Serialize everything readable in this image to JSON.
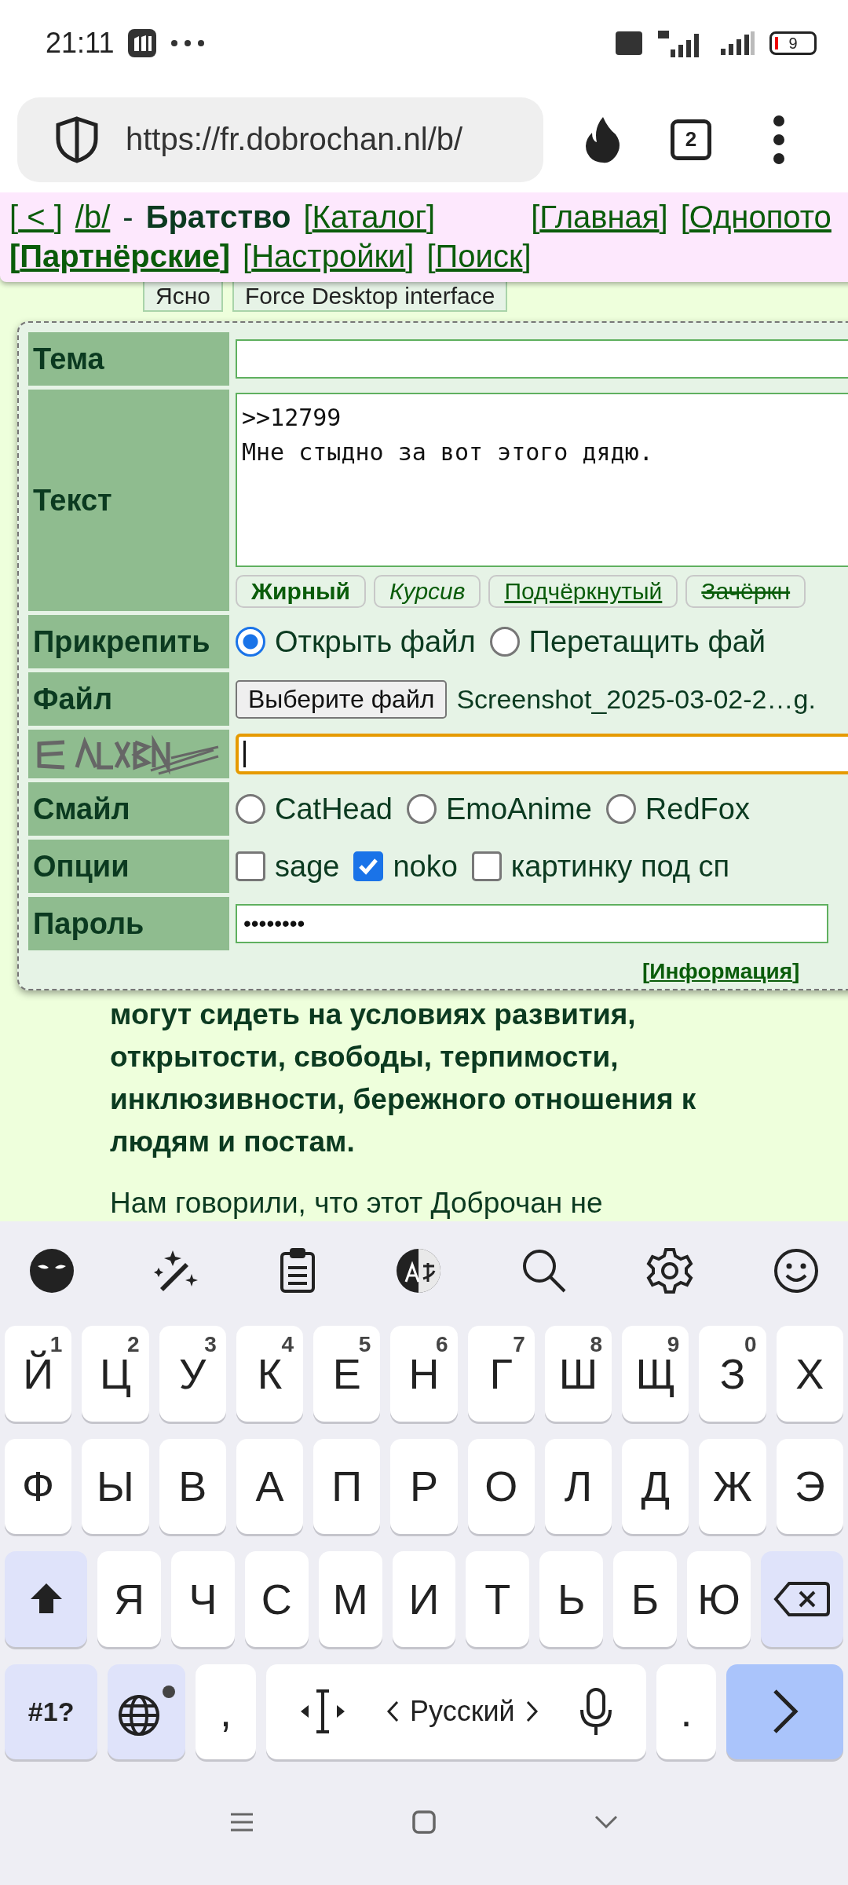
{
  "status_bar": {
    "time": "21:11",
    "battery": "9"
  },
  "browser": {
    "url": "https://fr.dobrochan.nl/b/",
    "tab_count": "2"
  },
  "nav": {
    "lines": [
      [
        {
          "kind": "link",
          "open": "[",
          "label": " < ",
          "close": "]",
          "bold": false
        },
        {
          "kind": "link",
          "label": "/b/",
          "bold": false
        },
        {
          "kind": "text",
          "label": "-"
        },
        {
          "kind": "title",
          "label": "Братство"
        },
        {
          "kind": "link",
          "open": "[",
          "label": "Каталог",
          "close": "]",
          "bold": false
        },
        {
          "kind": "spacer"
        },
        {
          "kind": "link",
          "open": "[",
          "label": "Главная",
          "close": "]",
          "bold": false
        },
        {
          "kind": "link",
          "open": "[",
          "label": "Однопото",
          "bold": false
        }
      ],
      [
        {
          "kind": "link",
          "open": "[",
          "label": "Партнёрские",
          "close": "]",
          "bold": true
        },
        {
          "kind": "link",
          "open": "[",
          "label": "Настройки",
          "close": "]",
          "bold": false
        },
        {
          "kind": "link",
          "open": "[",
          "label": "Поиск",
          "close": "]",
          "bold": false
        }
      ]
    ]
  },
  "banner": {
    "buttons": [
      "Ясно",
      "Force Desktop interface"
    ]
  },
  "form": {
    "rows": [
      {
        "kind": "input",
        "label": "Тема"
      },
      {
        "kind": "textarea",
        "label": "Текст",
        "value": ">>12799\nМне стыдно за вот этого дядю.",
        "format_buttons": [
          {
            "label": "Жирный",
            "kind": "bold"
          },
          {
            "label": "Курсив",
            "kind": "italic"
          },
          {
            "label": "Подчёркнутый",
            "kind": "underline"
          },
          {
            "label": "Зачёркн",
            "kind": "strike"
          }
        ]
      },
      {
        "kind": "radios",
        "label": "Прикрепить",
        "options": [
          {
            "label": "Открыть файл",
            "selected": true
          },
          {
            "label": "Перетащить фай",
            "selected": false
          }
        ]
      },
      {
        "kind": "file",
        "label": "Файл",
        "button": "Выберите файл",
        "filename": "Screenshot_2025-03-02-2…g."
      },
      {
        "kind": "captcha",
        "focused": true
      },
      {
        "kind": "radios",
        "label": "Смайл",
        "options": [
          {
            "label": "CatHead",
            "selected": false
          },
          {
            "label": "EmoAnime",
            "selected": false
          },
          {
            "label": "RedFox",
            "selected": false
          }
        ]
      },
      {
        "kind": "checks",
        "label": "Опции",
        "options": [
          {
            "label": "sage",
            "checked": false
          },
          {
            "label": "noko",
            "checked": true
          },
          {
            "label": "картинку под сп",
            "checked": false
          }
        ]
      },
      {
        "kind": "password",
        "label": "Пароль",
        "value": "••••••••"
      }
    ],
    "info_link": {
      "open": "[",
      "label": "Информация",
      "close": "]"
    }
  },
  "post": {
    "paragraphs": [
      {
        "text": "могут сидеть на условиях развития, открытости, свободы, терпимости, инклюзивности, бережного отношения к людям и постам.",
        "bold": true
      },
      {
        "text": "Нам говорили, что этот Доброчан не",
        "bold": false
      }
    ]
  },
  "keyboard": {
    "rows": [
      {
        "keys": [
          {
            "kind": "letter",
            "label": "Й",
            "hint": "1"
          },
          {
            "kind": "letter",
            "label": "Ц",
            "hint": "2"
          },
          {
            "kind": "letter",
            "label": "У",
            "hint": "3"
          },
          {
            "kind": "letter",
            "label": "К",
            "hint": "4"
          },
          {
            "kind": "letter",
            "label": "Е",
            "hint": "5"
          },
          {
            "kind": "letter",
            "label": "Н",
            "hint": "6"
          },
          {
            "kind": "letter",
            "label": "Г",
            "hint": "7"
          },
          {
            "kind": "letter",
            "label": "Ш",
            "hint": "8"
          },
          {
            "kind": "letter",
            "label": "Щ",
            "hint": "9"
          },
          {
            "kind": "letter",
            "label": "З",
            "hint": "0"
          },
          {
            "kind": "letter",
            "label": "Х"
          }
        ]
      },
      {
        "keys": [
          {
            "kind": "letter",
            "label": "Ф"
          },
          {
            "kind": "letter",
            "label": "Ы"
          },
          {
            "kind": "letter",
            "label": "В"
          },
          {
            "kind": "letter",
            "label": "А"
          },
          {
            "kind": "letter",
            "label": "П"
          },
          {
            "kind": "letter",
            "label": "Р"
          },
          {
            "kind": "letter",
            "label": "О"
          },
          {
            "kind": "letter",
            "label": "Л"
          },
          {
            "kind": "letter",
            "label": "Д"
          },
          {
            "kind": "letter",
            "label": "Ж"
          },
          {
            "kind": "letter",
            "label": "Э"
          }
        ]
      },
      {
        "keys": [
          {
            "kind": "shift"
          },
          {
            "kind": "letter",
            "label": "Я"
          },
          {
            "kind": "letter",
            "label": "Ч"
          },
          {
            "kind": "letter",
            "label": "С"
          },
          {
            "kind": "letter",
            "label": "М"
          },
          {
            "kind": "letter",
            "label": "И"
          },
          {
            "kind": "letter",
            "label": "Т"
          },
          {
            "kind": "letter",
            "label": "Ь"
          },
          {
            "kind": "letter",
            "label": "Б"
          },
          {
            "kind": "letter",
            "label": "Ю"
          },
          {
            "kind": "backspace"
          }
        ]
      },
      {
        "keys": [
          {
            "kind": "symbols",
            "label": "#1?"
          },
          {
            "kind": "language"
          },
          {
            "kind": "letter",
            "label": ","
          },
          {
            "kind": "space",
            "label": "Русский"
          },
          {
            "kind": "letter",
            "label": "."
          },
          {
            "kind": "enter"
          }
        ]
      }
    ]
  }
}
